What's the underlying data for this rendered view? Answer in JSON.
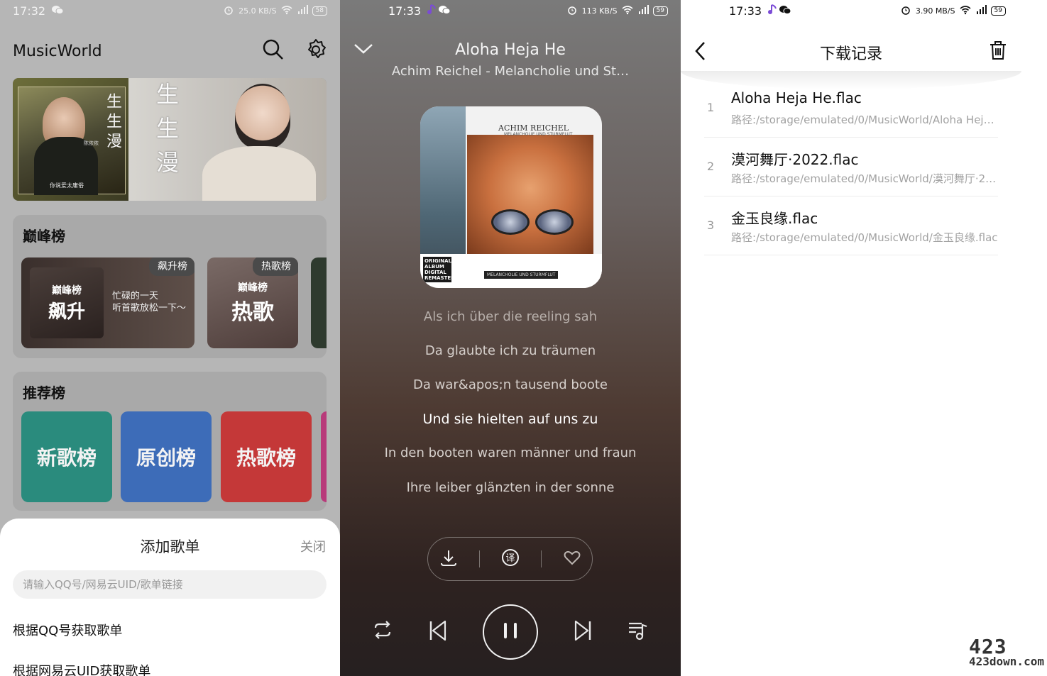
{
  "screen1": {
    "status": {
      "time": "17:32",
      "speed": "25.0 KB/S",
      "battery": "58"
    },
    "app_title": "MusicWorld",
    "banner": {
      "title_left": "生生漫",
      "title_right": "生生漫",
      "artist_small": "陈依依",
      "caption": "你说爱太庸俗"
    },
    "peak": {
      "title": "巅峰榜",
      "tiles": [
        {
          "badge": "飙升榜",
          "art_small": "巅峰榜",
          "art_big": "飙升",
          "desc1": "忙碌的一天",
          "desc2": "听首歌放松一下～"
        },
        {
          "badge": "热歌榜",
          "art_small": "巅峰榜",
          "art_big": "热歌"
        }
      ]
    },
    "recommend": {
      "title": "推荐榜",
      "tiles": [
        {
          "label": "新歌榜",
          "color": "#2f9e8c"
        },
        {
          "label": "原创榜",
          "color": "#3f74c4"
        },
        {
          "label": "热歌榜",
          "color": "#d63b3b"
        }
      ]
    },
    "sheet": {
      "title": "添加歌单",
      "close": "关闭",
      "input_placeholder": "请输入QQ号/网易云UID/歌单链接",
      "option1": "根据QQ号获取歌单",
      "option2": "根据网易云UID获取歌单"
    }
  },
  "screen2": {
    "status": {
      "time": "17:33",
      "speed": "113 KB/S",
      "battery": "59"
    },
    "title": "Aloha Heja He",
    "subtitle": "Achim Reichel - Melancholie und St…",
    "album": {
      "header": "ACHIM REICHEL",
      "header2": "MELANCHOLIE UND STURMFLUT",
      "tag": "ORIGINAL ALBUM DIGITAL REMASTERED",
      "footer": "MELANCHOLIE UND STURMFLUT"
    },
    "lyrics": [
      "Als ich über die reeling sah",
      "Da glaubte ich zu träumen",
      "Da war&apos;n tausend boote",
      "Und sie hielten auf uns zu",
      "In den booten waren männer und fraun",
      "Ihre leiber glänzten in der sonne"
    ],
    "active_lyric_index": 3,
    "translate_label": "译"
  },
  "screen3": {
    "status": {
      "time": "17:33",
      "speed": "3.90 MB/S",
      "battery": "59"
    },
    "title": "下载记录",
    "items": [
      {
        "index": "1",
        "name": "Aloha Heja He.flac",
        "path": "路径:/storage/emulated/0/MusicWorld/Aloha Heja…"
      },
      {
        "index": "2",
        "name": "漠河舞厅·2022.flac",
        "path": "路径:/storage/emulated/0/MusicWorld/漠河舞厅·20…"
      },
      {
        "index": "3",
        "name": "金玉良缘.flac",
        "path": "路径:/storage/emulated/0/MusicWorld/金玉良缘.flac"
      }
    ],
    "watermark": {
      "num": "423",
      "down": "423down.com"
    }
  }
}
